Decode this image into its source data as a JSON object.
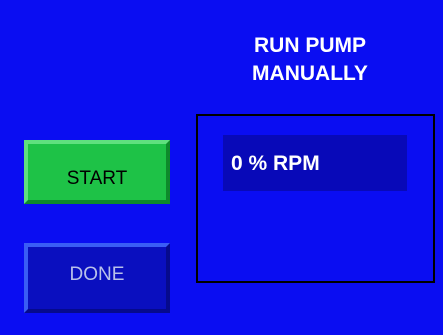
{
  "title": {
    "line1": "RUN PUMP",
    "line2": "MANUALLY"
  },
  "buttons": {
    "start_label": "START",
    "done_label": "DONE"
  },
  "readout": {
    "value": "0 % RPM"
  },
  "colors": {
    "background": "#0a0df2",
    "start_button": "#1ec247",
    "done_button": "#0a0fbf",
    "readout_box": "#0809b8"
  }
}
